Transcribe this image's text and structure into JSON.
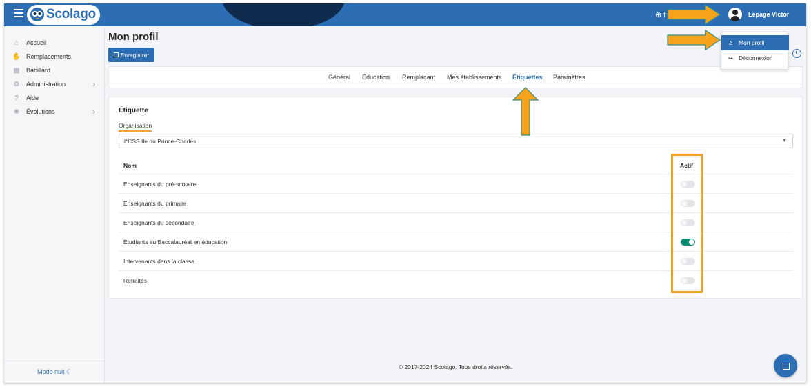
{
  "header": {
    "brand": "Scolago",
    "user_name": "Lepage Victor",
    "globe_label": "⊕ f"
  },
  "sidebar": {
    "items": [
      {
        "label": "Accueil",
        "icon": "home-icon"
      },
      {
        "label": "Remplacements",
        "icon": "handshake-icon"
      },
      {
        "label": "Babillard",
        "icon": "bulletin-icon"
      },
      {
        "label": "Administration",
        "icon": "gear-icon",
        "chevron": true
      },
      {
        "label": "Aide",
        "icon": "question-icon"
      },
      {
        "label": "Évolutions",
        "icon": "sprout-icon",
        "chevron": true
      }
    ],
    "footer_label": "Mode nuit ☾"
  },
  "main": {
    "page_title": "Mon profil",
    "save_label": "Enregistrer",
    "tabs": [
      {
        "label": "Général"
      },
      {
        "label": "Éducation"
      },
      {
        "label": "Remplaçant"
      },
      {
        "label": "Mes établissements"
      },
      {
        "label": "Étiquettes",
        "active": true
      },
      {
        "label": "Paramètres"
      }
    ],
    "section_title": "Étiquette",
    "organisation_label": "Organisation",
    "organisation_value": "l*CSS Ile du Prince-Charles",
    "table": {
      "headers": {
        "name": "Nom",
        "active": "Actif"
      },
      "rows": [
        {
          "name": "Enseignants du pré-scolaire",
          "active": false
        },
        {
          "name": "Enseignants du primaire",
          "active": false
        },
        {
          "name": "Enseignants du secondaire",
          "active": false
        },
        {
          "name": "Étudiants au Baccalauréat en éducation",
          "active": true
        },
        {
          "name": "Intervenants dans la classe",
          "active": false
        },
        {
          "name": "Retraités",
          "active": false
        }
      ]
    }
  },
  "user_menu": {
    "items": [
      {
        "label": "Mon profil",
        "icon": "user-icon",
        "active": true
      },
      {
        "label": "Déconnexion",
        "icon": "logout-icon"
      }
    ]
  },
  "footer": {
    "copyright": "© 2017-2024 Scolago. Tous droits réservés."
  },
  "colors": {
    "primary": "#2d6db3",
    "header_dark": "#0f2c4f",
    "toggle_on": "#0f8a72",
    "annotation": "#f7a21b"
  }
}
